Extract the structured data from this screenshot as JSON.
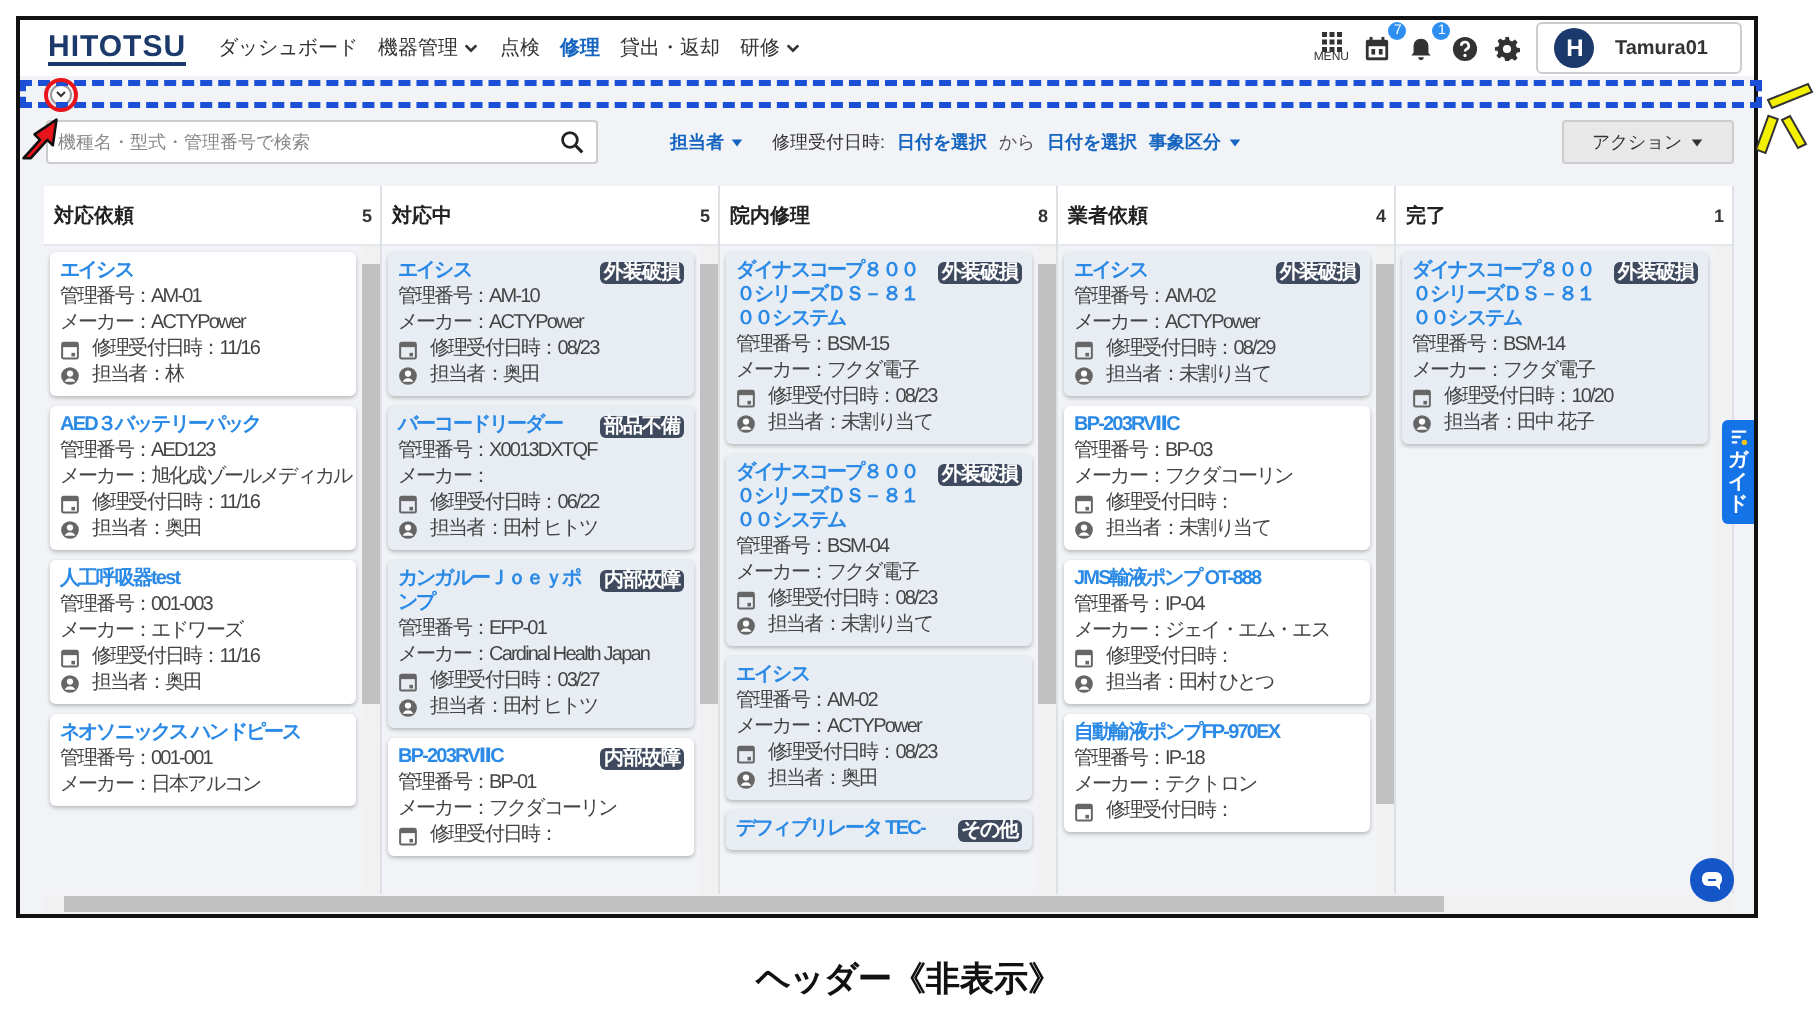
{
  "header": {
    "logo": "HITOTSU",
    "nav": [
      {
        "label": "ダッシュボード",
        "selected": false,
        "dropdown": false
      },
      {
        "label": "機器管理",
        "selected": false,
        "dropdown": true
      },
      {
        "label": "点検",
        "selected": false,
        "dropdown": false
      },
      {
        "label": "修理",
        "selected": true,
        "dropdown": false
      },
      {
        "label": "貸出・返却",
        "selected": false,
        "dropdown": false
      },
      {
        "label": "研修",
        "selected": false,
        "dropdown": true
      }
    ],
    "menu_label": "MENU",
    "calendar_badge": "7",
    "notification_badge": "1",
    "user": {
      "initial": "H",
      "name": "Tamura01"
    }
  },
  "toolbar": {
    "search": {
      "placeholder": "機種名・型式・管理番号で検索"
    },
    "assignee_filter": "担当者",
    "date_label": "修理受付日時:",
    "date_from": "日付を選択",
    "date_sep": "から",
    "date_to": "日付を選択",
    "event_filter": "事象区分",
    "action_button": "アクション"
  },
  "columns": [
    {
      "title": "対応依頼",
      "count": "5",
      "cards": [
        {
          "title": "エイシス",
          "highlighted": false,
          "lines": [
            {
              "kind": "id",
              "text": "管理番号：AM-01"
            },
            {
              "kind": "maker",
              "text": "メーカー：ACTYPower"
            },
            {
              "kind": "date",
              "text": "修理受付日時：11/16"
            },
            {
              "kind": "assignee",
              "text": "担当者：林"
            }
          ]
        },
        {
          "title": "AED３バッテリーパック",
          "highlighted": false,
          "lines": [
            {
              "kind": "id",
              "text": "管理番号：AED123"
            },
            {
              "kind": "maker",
              "text": "メーカー：旭化成ゾールメディカル"
            },
            {
              "kind": "date",
              "text": "修理受付日時：11/16"
            },
            {
              "kind": "assignee",
              "text": "担当者：奥田"
            }
          ]
        },
        {
          "title": "人工呼吸器test",
          "highlighted": false,
          "lines": [
            {
              "kind": "id",
              "text": "管理番号：001-003"
            },
            {
              "kind": "maker",
              "text": "メーカー：エドワーズ"
            },
            {
              "kind": "date",
              "text": "修理受付日時：11/16"
            },
            {
              "kind": "assignee",
              "text": "担当者：奥田"
            }
          ]
        },
        {
          "title": "ネオソニックス ハンドピース",
          "highlighted": false,
          "lines": [
            {
              "kind": "id",
              "text": "管理番号：001-001"
            },
            {
              "kind": "maker",
              "text": "メーカー：日本アルコン"
            }
          ]
        }
      ]
    },
    {
      "title": "対応中",
      "count": "5",
      "cards": [
        {
          "title": "エイシス",
          "badge": "外装破損",
          "highlighted": true,
          "lines": [
            {
              "kind": "id",
              "text": "管理番号：AM-10"
            },
            {
              "kind": "maker",
              "text": "メーカー：ACTYPower"
            },
            {
              "kind": "date",
              "text": "修理受付日時：08/23"
            },
            {
              "kind": "assignee",
              "text": "担当者：奥田"
            }
          ]
        },
        {
          "title": "バーコードリーダー",
          "badge": "部品不備",
          "highlighted": true,
          "lines": [
            {
              "kind": "id",
              "text": "管理番号：X0013DXTQF"
            },
            {
              "kind": "maker",
              "text": "メーカー："
            },
            {
              "kind": "date",
              "text": "修理受付日時：06/22"
            },
            {
              "kind": "assignee",
              "text": "担当者：田村 ヒトツ"
            }
          ]
        },
        {
          "title": "カンガルーＪｏｅｙポンプ",
          "badge": "内部故障",
          "highlighted": true,
          "lines": [
            {
              "kind": "id",
              "text": "管理番号：EFP-01"
            },
            {
              "kind": "maker",
              "text": "メーカー：Cardinal Health Japan"
            },
            {
              "kind": "date",
              "text": "修理受付日時：03/27"
            },
            {
              "kind": "assignee",
              "text": "担当者：田村 ヒトツ"
            }
          ]
        },
        {
          "title": "BP-203RVⅡC",
          "badge": "内部故障",
          "highlighted": false,
          "lines": [
            {
              "kind": "id",
              "text": "管理番号：BP-01"
            },
            {
              "kind": "maker",
              "text": "メーカー：フクダコーリン"
            },
            {
              "kind": "date",
              "text": "修理受付日時："
            }
          ]
        }
      ]
    },
    {
      "title": "院内修理",
      "count": "8",
      "cards": [
        {
          "title": "ダイナスコープ８０００シリーズＤＳ－８１００システム",
          "badge": "外装破損",
          "highlighted": true,
          "lines": [
            {
              "kind": "id",
              "text": "管理番号：BSM-15"
            },
            {
              "kind": "maker",
              "text": "メーカー：フクダ電子"
            },
            {
              "kind": "date",
              "text": "修理受付日時：08/23"
            },
            {
              "kind": "assignee",
              "text": "担当者：未割り当て"
            }
          ]
        },
        {
          "title": "ダイナスコープ８０００シリーズＤＳ－８１００システム",
          "badge": "外装破損",
          "highlighted": true,
          "lines": [
            {
              "kind": "id",
              "text": "管理番号：BSM-04"
            },
            {
              "kind": "maker",
              "text": "メーカー：フクダ電子"
            },
            {
              "kind": "date",
              "text": "修理受付日時：08/23"
            },
            {
              "kind": "assignee",
              "text": "担当者：未割り当て"
            }
          ]
        },
        {
          "title": "エイシス",
          "highlighted": true,
          "lines": [
            {
              "kind": "id",
              "text": "管理番号：AM-02"
            },
            {
              "kind": "maker",
              "text": "メーカー：ACTYPower"
            },
            {
              "kind": "date",
              "text": "修理受付日時：08/23"
            },
            {
              "kind": "assignee",
              "text": "担当者：奥田"
            }
          ]
        },
        {
          "title": "デフィブリレータ TEC-",
          "badge": "その他",
          "highlighted": true
        }
      ]
    },
    {
      "title": "業者依頼",
      "count": "4",
      "cards": [
        {
          "title": "エイシス",
          "badge": "外装破損",
          "highlighted": true,
          "lines": [
            {
              "kind": "id",
              "text": "管理番号：AM-02"
            },
            {
              "kind": "maker",
              "text": "メーカー：ACTYPower"
            },
            {
              "kind": "date",
              "text": "修理受付日時：08/29"
            },
            {
              "kind": "assignee",
              "text": "担当者：未割り当て"
            }
          ]
        },
        {
          "title": "BP-203RVⅡC",
          "highlighted": false,
          "lines": [
            {
              "kind": "id",
              "text": "管理番号：BP-03"
            },
            {
              "kind": "maker",
              "text": "メーカー：フクダコーリン"
            },
            {
              "kind": "date",
              "text": "修理受付日時："
            },
            {
              "kind": "assignee",
              "text": "担当者：未割り当て"
            }
          ]
        },
        {
          "title": "JMS輸液ポンプ OT-888",
          "highlighted": false,
          "lines": [
            {
              "kind": "id",
              "text": "管理番号：IP-04"
            },
            {
              "kind": "maker",
              "text": "メーカー：ジェイ・エム・エス"
            },
            {
              "kind": "date",
              "text": "修理受付日時："
            },
            {
              "kind": "assignee",
              "text": "担当者：田村 ひとつ"
            }
          ]
        },
        {
          "title": "自動輸液ポンプFP-970EX",
          "highlighted": false,
          "lines": [
            {
              "kind": "id",
              "text": "管理番号：IP-18"
            },
            {
              "kind": "maker",
              "text": "メーカー：テクトロン"
            },
            {
              "kind": "date",
              "text": "修理受付日時："
            }
          ]
        }
      ]
    },
    {
      "title": "完了",
      "count": "1",
      "cards": [
        {
          "title": "ダイナスコープ８０００シリーズＤＳ－８１００システム",
          "badge": "外装破損",
          "highlighted": true,
          "lines": [
            {
              "kind": "id",
              "text": "管理番号：BSM-14"
            },
            {
              "kind": "maker",
              "text": "メーカー：フクダ電子"
            },
            {
              "kind": "date",
              "text": "修理受付日時：10/20"
            },
            {
              "kind": "assignee",
              "text": "担当者：田中 花子"
            }
          ]
        }
      ]
    }
  ],
  "guide_tab": "ガイド",
  "caption": "ヘッダー《非表示》"
}
